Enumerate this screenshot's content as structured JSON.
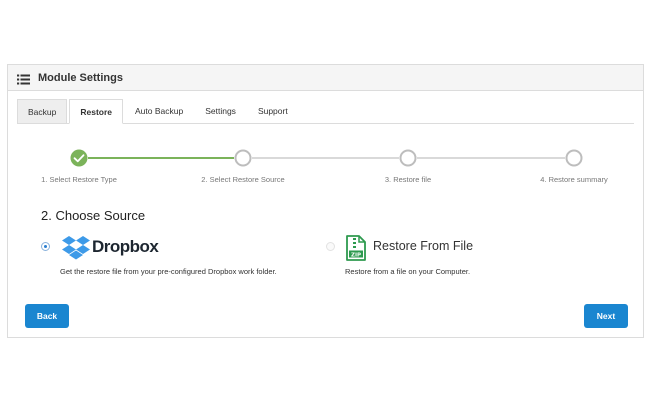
{
  "panel": {
    "title": "Module Settings",
    "header_icon": "list-icon"
  },
  "tabs": [
    {
      "label": "Backup",
      "active": false
    },
    {
      "label": "Restore",
      "active": true
    },
    {
      "label": "Auto Backup",
      "active": false
    },
    {
      "label": "Settings",
      "active": false
    },
    {
      "label": "Support",
      "active": false
    }
  ],
  "wizard": {
    "steps": [
      {
        "label": "1. Select Restore Type",
        "status": "complete"
      },
      {
        "label": "2. Select Restore Source",
        "status": "current"
      },
      {
        "label": "3. Restore file",
        "status": "pending"
      },
      {
        "label": "4. Restore summary",
        "status": "pending"
      }
    ],
    "complete_color": "#7bb35a",
    "pending_color": "#d9d9d9"
  },
  "choose_source": {
    "title": "2. Choose Source",
    "options": [
      {
        "name": "Dropbox",
        "icon": "dropbox-icon",
        "selected": true,
        "description": "Get the restore file from your pre-configured Dropbox work folder."
      },
      {
        "name": "Restore From File",
        "icon": "zip-file-icon",
        "selected": false,
        "description": "Restore from a file on your Computer."
      }
    ]
  },
  "buttons": {
    "back": "Back",
    "next": "Next",
    "color": "#1a86d0"
  }
}
